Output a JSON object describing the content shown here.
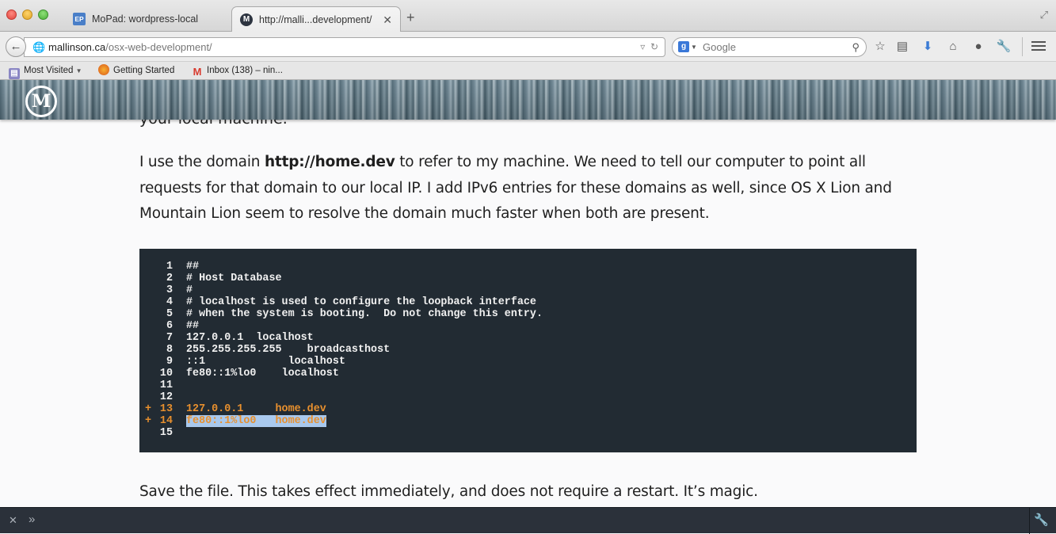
{
  "browser": {
    "tabs": [
      {
        "label": "MoPad: wordpress-local",
        "favicon": "EP",
        "active": false
      },
      {
        "label": "http://malli...development/",
        "favicon": "M",
        "active": true
      }
    ],
    "new_tab_label": "+",
    "url_host": "mallinson.ca",
    "url_path": "/osx-web-development/",
    "search_engine": "Google",
    "search_placeholder": "Google",
    "bookmarks": [
      "Most Visited",
      "Getting Started",
      "Inbox (138) – nin..."
    ]
  },
  "site": {
    "logo_letter": "M"
  },
  "article": {
    "previous_line": "your local machine.",
    "para1_before": "I use the domain ",
    "para1_bold": "http://home.dev",
    "para1_after": " to refer to my machine. We need to tell our computer to point all requests for that domain to our local IP. I add IPv6 entries for these domains as well, since OS X Lion and Mountain Lion seem to resolve the domain much faster when both are present.",
    "para2": "Save the file. This takes effect immediately, and does not require a restart. It’s magic."
  },
  "code_block": {
    "lines": [
      {
        "n": "1",
        "text": "##",
        "added": false
      },
      {
        "n": "2",
        "text": "# Host Database",
        "added": false
      },
      {
        "n": "3",
        "text": "#",
        "added": false
      },
      {
        "n": "4",
        "text": "# localhost is used to configure the loopback interface",
        "added": false
      },
      {
        "n": "5",
        "text": "# when the system is booting.  Do not change this entry.",
        "added": false
      },
      {
        "n": "6",
        "text": "##",
        "added": false
      },
      {
        "n": "7",
        "text": "127.0.0.1  localhost",
        "added": false
      },
      {
        "n": "8",
        "text": "255.255.255.255    broadcasthost",
        "added": false
      },
      {
        "n": "9",
        "text": "::1             localhost",
        "added": false
      },
      {
        "n": "10",
        "text": "fe80::1%lo0    localhost",
        "added": false
      },
      {
        "n": "11",
        "text": "",
        "added": false
      },
      {
        "n": "12",
        "text": "",
        "added": false
      },
      {
        "n": "13",
        "text": "127.0.0.1     home.dev",
        "added": true
      },
      {
        "n": "14",
        "text": "fe80::1%lo0   home.dev",
        "added": true,
        "selected": true
      },
      {
        "n": "15",
        "text": "",
        "added": false
      }
    ],
    "added_marker": "+",
    "added_color": "#e8902e",
    "background_color": "#222b33",
    "selection_color": "#a9c9ee"
  },
  "icons": [
    "back-arrow-icon",
    "globe-icon",
    "reload-icon",
    "search-icon",
    "star-icon",
    "clipboard-icon",
    "download-icon",
    "home-icon",
    "chat-icon",
    "wrench-icon",
    "menu-icon",
    "close-icon",
    "chevron-right-icon"
  ]
}
